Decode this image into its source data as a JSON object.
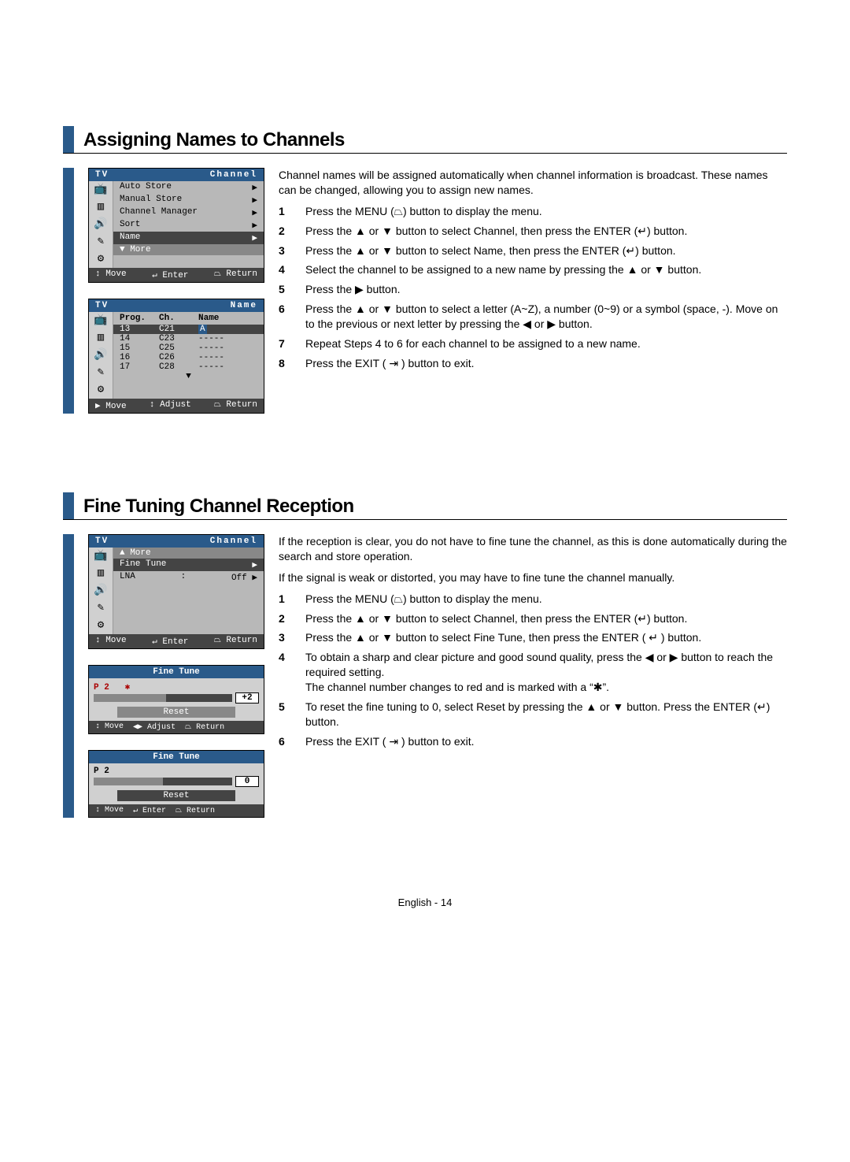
{
  "section1": {
    "title": "Assigning Names to Channels",
    "intro": "Channel names will be assigned automatically when channel information is broadcast. These names can be changed, allowing you to assign new names.",
    "steps": [
      {
        "n": "1",
        "t": "Press the MENU (⏢) button to display the menu."
      },
      {
        "n": "2",
        "t": "Press the ▲ or ▼ button to select Channel, then press the ENTER (↵) button."
      },
      {
        "n": "3",
        "t": "Press the ▲ or ▼ button to select Name, then press the ENTER (↵) button."
      },
      {
        "n": "4",
        "t": "Select the channel to be assigned to a new name by pressing the ▲ or ▼ button."
      },
      {
        "n": "5",
        "t": "Press the ▶ button."
      },
      {
        "n": "6",
        "t": "Press the ▲ or ▼ button to select a letter (A~Z), a number (0~9) or a symbol (space, -). Move on to the previous or next letter by pressing the ◀ or ▶ button."
      },
      {
        "n": "7",
        "t": "Repeat Steps 4 to 6 for each channel to be assigned to a new name."
      },
      {
        "n": "8",
        "t": "Press the EXIT ( ⇥ ) button to exit."
      }
    ],
    "osd1": {
      "tv": "TV",
      "title": "Channel",
      "items": [
        "Auto Store",
        "Manual Store",
        "Channel Manager",
        "Sort",
        "Name"
      ],
      "more": "▼ More",
      "foot": {
        "move": "↕ Move",
        "enter": "↵ Enter",
        "return": "⏢ Return"
      }
    },
    "osd2": {
      "tv": "TV",
      "title": "Name",
      "head": {
        "p": "Prog.",
        "c": "Ch.",
        "n": "Name"
      },
      "rows": [
        {
          "p": "13",
          "c": "C21",
          "n": "A",
          "sel": true
        },
        {
          "p": "14",
          "c": "C23",
          "n": "-----"
        },
        {
          "p": "15",
          "c": "C25",
          "n": "-----"
        },
        {
          "p": "16",
          "c": "C26",
          "n": "-----"
        },
        {
          "p": "17",
          "c": "C28",
          "n": "-----"
        }
      ],
      "more": "▼",
      "foot": {
        "move": "▶ Move",
        "adjust": "↕ Adjust",
        "return": "⏢ Return"
      }
    }
  },
  "section2": {
    "title": "Fine Tuning Channel Reception",
    "intro1": "If the reception is clear, you do not have to fine tune the channel, as this is done automatically during the search and store operation.",
    "intro2": "If the signal is weak or distorted, you may have to fine tune the channel manually.",
    "steps": [
      {
        "n": "1",
        "t": "Press the MENU (⏢) button to display the menu."
      },
      {
        "n": "2",
        "t": "Press the ▲ or ▼ button to select Channel, then press the ENTER (↵) button."
      },
      {
        "n": "3",
        "t": "Press the ▲ or ▼ button to select Fine Tune, then press the ENTER ( ↵ ) button."
      },
      {
        "n": "4",
        "t": "To obtain a sharp and clear picture and good sound quality, press the ◀ or ▶ button to reach the required setting.\nThe channel number changes to red and is marked with a “✱”."
      },
      {
        "n": "5",
        "t": "To reset the fine tuning to 0, select Reset by pressing the ▲ or ▼ button. Press the ENTER (↵) button."
      },
      {
        "n": "6",
        "t": "Press the EXIT ( ⇥ ) button to exit."
      }
    ],
    "osd1": {
      "tv": "TV",
      "title": "Channel",
      "more": "▲ More",
      "items": [
        {
          "l": "Fine Tune",
          "r": "▶",
          "sel": true
        },
        {
          "l": "LNA",
          "m": ":",
          "r": "Off  ▶"
        }
      ],
      "foot": {
        "move": "↕ Move",
        "enter": "↵ Enter",
        "return": "⏢ Return"
      }
    },
    "ft1": {
      "title": "Fine Tune",
      "ch": "P 2",
      "star": "✱",
      "val": "+2",
      "reset": "Reset",
      "foot": [
        "↕ Move",
        "◀▶ Adjust",
        "⏢ Return"
      ]
    },
    "ft2": {
      "title": "Fine Tune",
      "ch": "P 2",
      "val": "0",
      "reset": "Reset",
      "foot": [
        "↕ Move",
        "↵ Enter",
        "⏢ Return"
      ]
    }
  },
  "footer": "English - 14"
}
